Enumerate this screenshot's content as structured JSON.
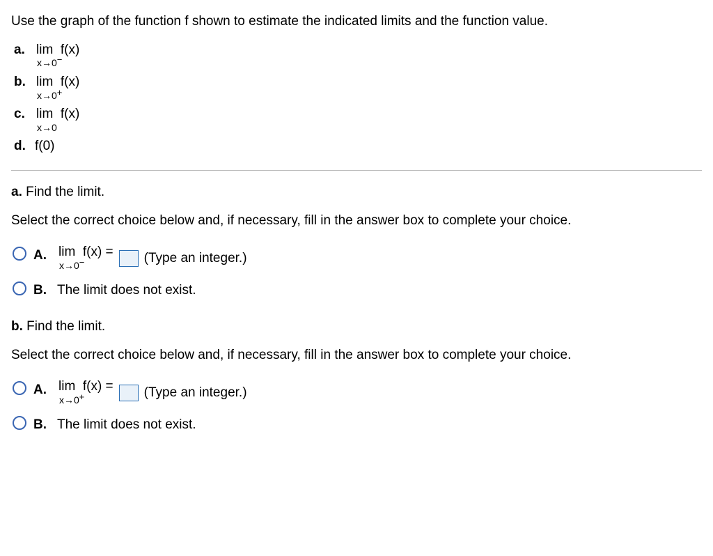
{
  "intro": "Use the graph of the function f shown to estimate the indicated limits and the function value.",
  "parts": {
    "a": {
      "label": "a.",
      "lim_word": "lim",
      "fx": "f(x)",
      "approach": "x→0",
      "side": "−"
    },
    "b": {
      "label": "b.",
      "lim_word": "lim",
      "fx": "f(x)",
      "approach": "x→0",
      "side": "+"
    },
    "c": {
      "label": "c.",
      "lim_word": "lim",
      "fx": "f(x)",
      "approach": "x→0",
      "side": ""
    },
    "d": {
      "label": "d.",
      "text": "f(0)"
    }
  },
  "section_a": {
    "heading_bold": "a.",
    "heading_rest": " Find the limit.",
    "instruction": "Select the correct choice below and, if necessary, fill in the answer box to complete your choice.",
    "choiceA": {
      "letter": "A.",
      "lim_word": "lim",
      "fx_eq": "f(x) =",
      "approach": "x→0",
      "side": "−",
      "hint": "(Type an integer.)"
    },
    "choiceB": {
      "letter": "B.",
      "text": "The limit does not exist."
    }
  },
  "section_b": {
    "heading_bold": "b.",
    "heading_rest": " Find the limit.",
    "instruction": "Select the correct choice below and, if necessary, fill in the answer box to complete your choice.",
    "choiceA": {
      "letter": "A.",
      "lim_word": "lim",
      "fx_eq": "f(x) =",
      "approach": "x→0",
      "side": "+",
      "hint": "(Type an integer.)"
    },
    "choiceB": {
      "letter": "B.",
      "text": "The limit does not exist."
    }
  }
}
